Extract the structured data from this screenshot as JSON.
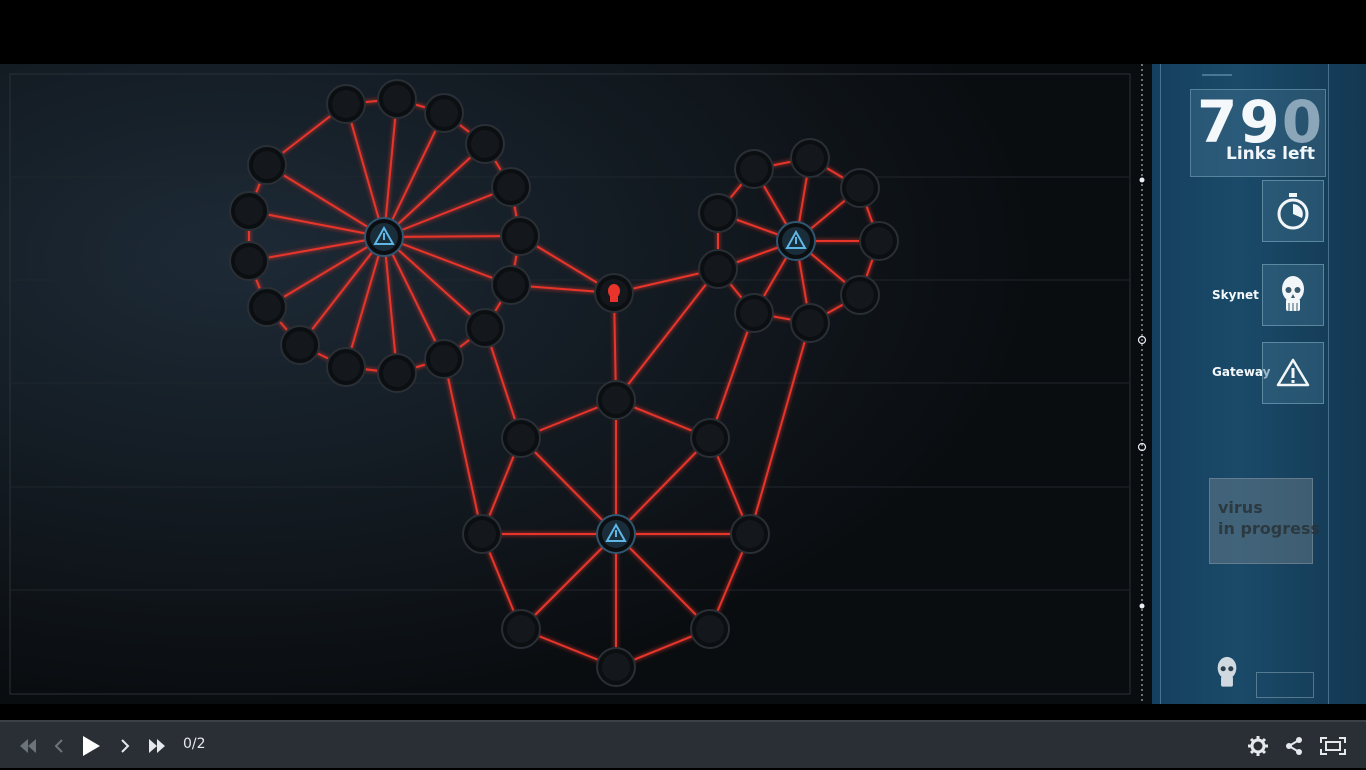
{
  "hud": {
    "count_digits": "79",
    "count_dim_digit": "0",
    "count_label": "Links left",
    "legend": [
      {
        "label": "Skynet",
        "icon": "skull-icon"
      },
      {
        "label": "Gateway",
        "icon": "gateway-warning-icon"
      }
    ],
    "timer_icon": "stopwatch-icon",
    "status": "virus\nin progress"
  },
  "player": {
    "frame": "0/2",
    "buttons": [
      "first-frame",
      "previous-frame",
      "play",
      "next-frame",
      "last-frame",
      "settings",
      "share",
      "fullscreen"
    ]
  },
  "colors": {
    "link": "#e8342b",
    "node_fill": "#14171b",
    "gateway": "#5fb7e6",
    "agent": "#e8342b"
  },
  "graph": {
    "nodes": [
      {
        "id": 0,
        "type": "gateway"
      },
      {
        "id": 1,
        "type": "node"
      },
      {
        "id": 2,
        "type": "node"
      },
      {
        "id": 3,
        "type": "node"
      },
      {
        "id": 4,
        "type": "node"
      },
      {
        "id": 5,
        "type": "node"
      },
      {
        "id": 6,
        "type": "node"
      },
      {
        "id": 7,
        "type": "node"
      },
      {
        "id": 8,
        "type": "node"
      },
      {
        "id": 9,
        "type": "node"
      },
      {
        "id": 10,
        "type": "node"
      },
      {
        "id": 11,
        "type": "node"
      },
      {
        "id": 12,
        "type": "node"
      },
      {
        "id": 13,
        "type": "node"
      },
      {
        "id": 14,
        "type": "node"
      },
      {
        "id": 15,
        "type": "node"
      },
      {
        "id": 16,
        "type": "node"
      },
      {
        "id": 17,
        "type": "agent"
      },
      {
        "id": 18,
        "type": "gateway"
      },
      {
        "id": 19,
        "type": "node"
      },
      {
        "id": 20,
        "type": "node"
      },
      {
        "id": 21,
        "type": "node"
      },
      {
        "id": 22,
        "type": "node"
      },
      {
        "id": 23,
        "type": "node"
      },
      {
        "id": 24,
        "type": "node"
      },
      {
        "id": 25,
        "type": "node"
      },
      {
        "id": 26,
        "type": "node"
      },
      {
        "id": 27,
        "type": "node"
      },
      {
        "id": 28,
        "type": "node"
      },
      {
        "id": 29,
        "type": "node"
      },
      {
        "id": 30,
        "type": "gateway"
      },
      {
        "id": 31,
        "type": "node"
      },
      {
        "id": 32,
        "type": "node"
      },
      {
        "id": 33,
        "type": "node"
      },
      {
        "id": 34,
        "type": "node"
      },
      {
        "id": 35,
        "type": "node"
      }
    ],
    "links": [
      [
        0,
        1
      ],
      [
        0,
        2
      ],
      [
        0,
        3
      ],
      [
        0,
        4
      ],
      [
        0,
        5
      ],
      [
        0,
        6
      ],
      [
        0,
        7
      ],
      [
        0,
        8
      ],
      [
        0,
        9
      ],
      [
        0,
        10
      ],
      [
        0,
        11
      ],
      [
        0,
        12
      ],
      [
        0,
        13
      ],
      [
        0,
        14
      ],
      [
        0,
        15
      ],
      [
        0,
        16
      ],
      [
        1,
        2
      ],
      [
        2,
        3
      ],
      [
        3,
        4
      ],
      [
        4,
        5
      ],
      [
        5,
        6
      ],
      [
        6,
        7
      ],
      [
        7,
        8
      ],
      [
        8,
        9
      ],
      [
        9,
        10
      ],
      [
        10,
        11
      ],
      [
        11,
        12
      ],
      [
        12,
        13
      ],
      [
        13,
        14
      ],
      [
        14,
        15
      ],
      [
        15,
        16
      ],
      [
        17,
        16
      ],
      [
        17,
        15
      ],
      [
        17,
        19
      ],
      [
        17,
        20
      ],
      [
        17,
        26
      ],
      [
        18,
        19
      ],
      [
        18,
        20
      ],
      [
        18,
        21
      ],
      [
        18,
        22
      ],
      [
        18,
        23
      ],
      [
        18,
        24
      ],
      [
        18,
        25
      ],
      [
        18,
        26
      ],
      [
        19,
        20
      ],
      [
        19,
        21
      ],
      [
        21,
        22
      ],
      [
        22,
        23
      ],
      [
        23,
        24
      ],
      [
        24,
        25
      ],
      [
        25,
        26
      ],
      [
        26,
        20
      ],
      [
        20,
        28
      ],
      [
        25,
        29
      ],
      [
        15,
        27
      ],
      [
        14,
        31
      ],
      [
        17,
        26
      ],
      [
        26,
        29
      ],
      [
        26,
        28
      ],
      [
        27,
        28
      ],
      [
        27,
        26
      ],
      [
        26,
        30
      ],
      [
        27,
        30
      ],
      [
        28,
        30
      ],
      [
        29,
        30
      ],
      [
        31,
        30
      ],
      [
        31,
        27
      ],
      [
        30,
        32
      ],
      [
        30,
        33
      ],
      [
        30,
        34
      ],
      [
        30,
        35
      ],
      [
        31,
        32
      ],
      [
        32,
        34
      ],
      [
        34,
        33
      ],
      [
        33,
        35
      ],
      [
        35,
        29
      ]
    ]
  }
}
